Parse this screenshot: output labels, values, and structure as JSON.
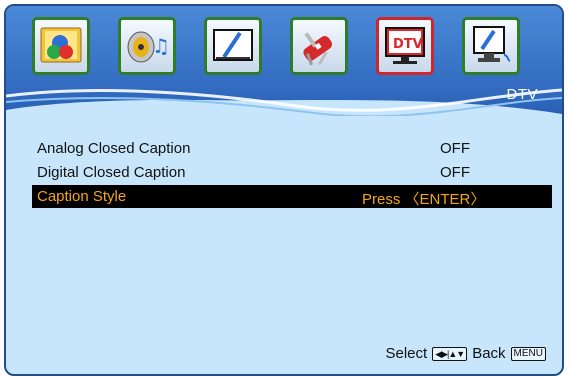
{
  "menu_tabs": [
    {
      "name": "picture-icon",
      "active": false
    },
    {
      "name": "sound-icon",
      "active": false
    },
    {
      "name": "screen-icon",
      "active": false
    },
    {
      "name": "setup-icon",
      "active": false
    },
    {
      "name": "dtv-icon",
      "active": true,
      "text": "DTV"
    },
    {
      "name": "pc-icon",
      "active": false
    }
  ],
  "page_title": "DTV",
  "rows": [
    {
      "label": "Analog Closed Caption",
      "value": "OFF",
      "selected": false
    },
    {
      "label": "Digital Closed Caption",
      "value": "OFF",
      "selected": false
    },
    {
      "label": "Caption Style",
      "value": "Press 〈ENTER〉",
      "selected": true
    }
  ],
  "footer": {
    "select_label": "Select",
    "select_keys_icon": "left-right-up-down-keys-icon",
    "back_label": "Back",
    "back_key": "MENU"
  },
  "colors": {
    "background": "#c7e6fb",
    "border": "#244c8c",
    "selected_bg": "#000000",
    "selected_text": "#f3a515",
    "tab_border": "#2f7d2a",
    "active_tab_border": "#d0262b"
  }
}
